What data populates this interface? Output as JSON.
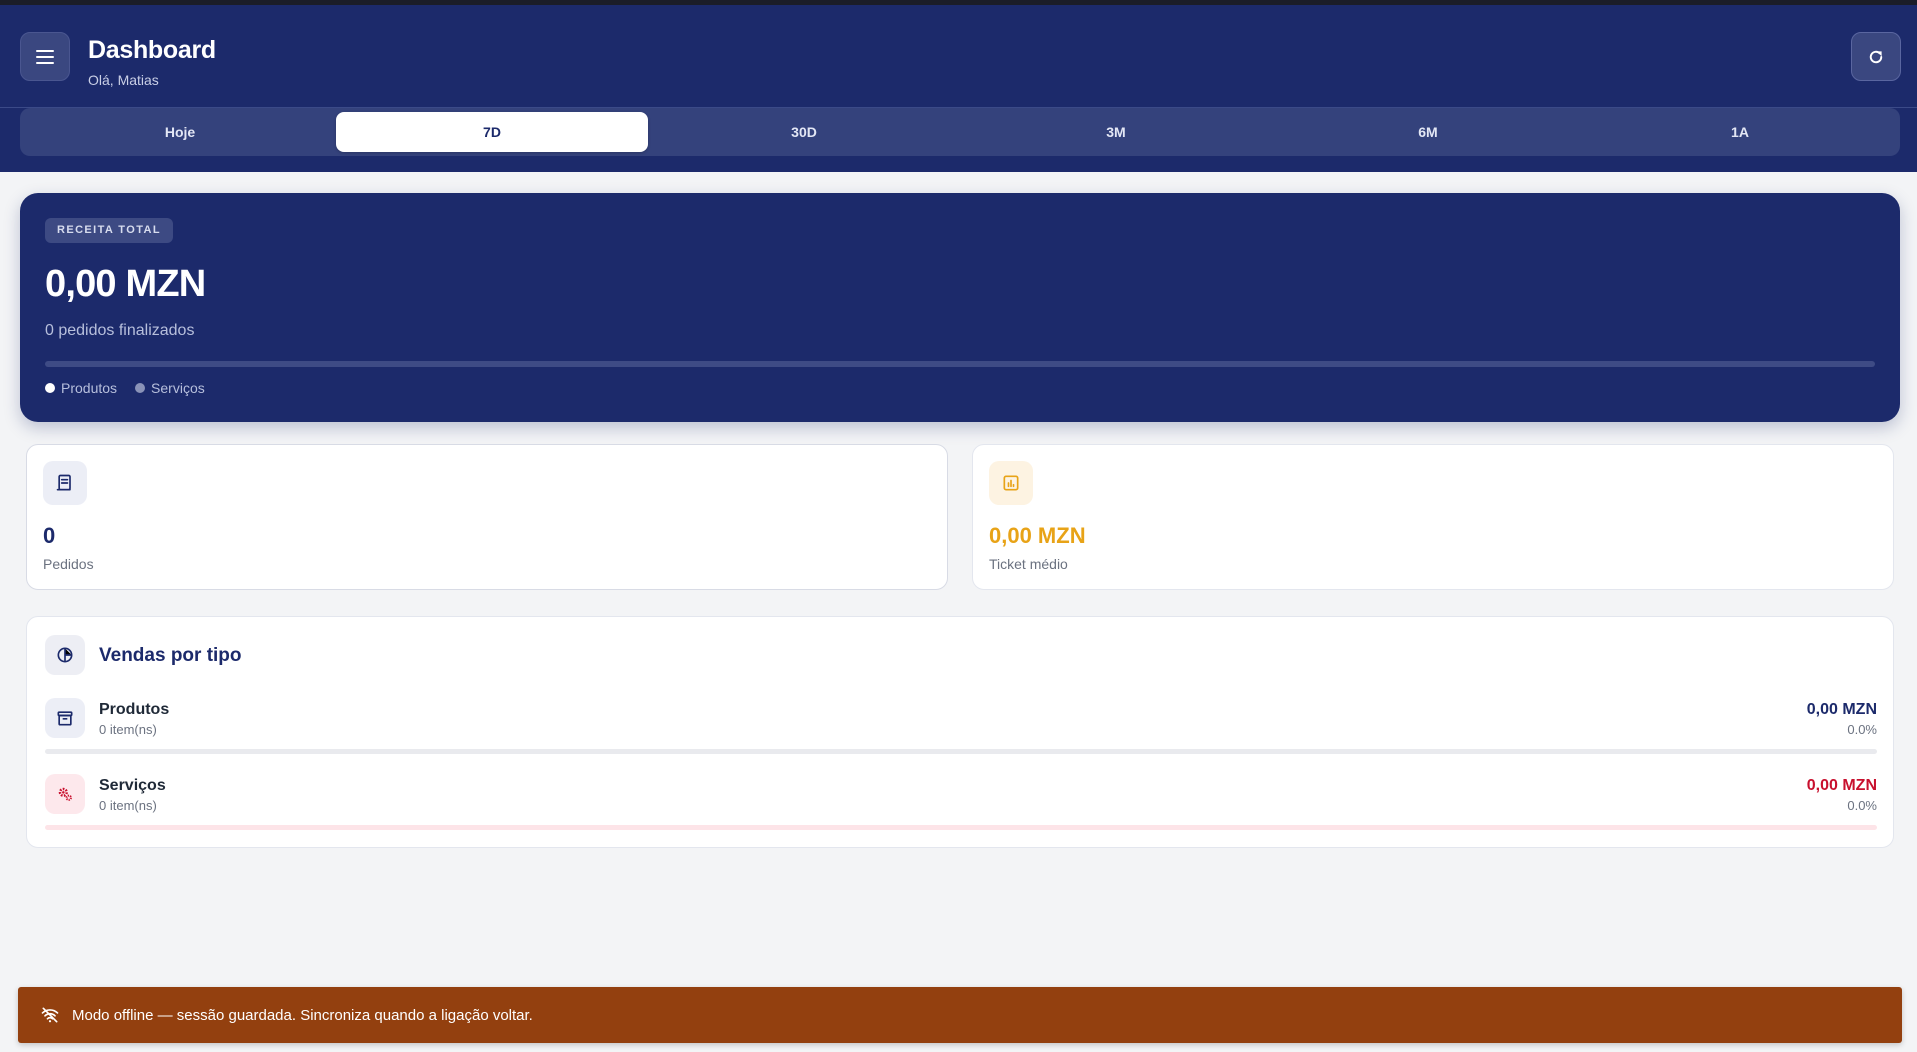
{
  "header": {
    "title": "Dashboard",
    "greeting": "Olá, Matias",
    "menu_icon": "hamburger-menu-icon",
    "refresh_icon": "refresh-icon",
    "bg_color": "#1c2a6b"
  },
  "period_tabs": [
    {
      "label": "Hoje",
      "active": false
    },
    {
      "label": "7D",
      "active": true
    },
    {
      "label": "30D",
      "active": false
    },
    {
      "label": "3M",
      "active": false
    },
    {
      "label": "6M",
      "active": false
    },
    {
      "label": "1A",
      "active": false
    }
  ],
  "revenue": {
    "badge": "RECEITA TOTAL",
    "amount": "0,00 MZN",
    "subtitle": "0 pedidos finalizados",
    "produtos_share": 0,
    "legend": [
      {
        "label": "Produtos",
        "color": "#ffffff"
      },
      {
        "label": "Serviços",
        "color": "#8a93b8"
      }
    ]
  },
  "stats": {
    "orders": {
      "value": "0",
      "label": "Pedidos",
      "icon": "receipt-icon",
      "color": "#1c2a6b"
    },
    "ticket": {
      "value": "0,00 MZN",
      "label": "Ticket médio",
      "icon": "bar-chart-icon",
      "color": "#e8a317"
    }
  },
  "sales_by_type": {
    "title": "Vendas por tipo",
    "icon": "pie-chart-icon",
    "rows": [
      {
        "name": "Produtos",
        "count": "0 item(ns)",
        "amount": "0,00 MZN",
        "percent": "0.0%",
        "share": 0,
        "icon": "archive-box-icon",
        "color": "#1c2a6b",
        "track_color": "#e9eaee"
      },
      {
        "name": "Serviços",
        "count": "0 item(ns)",
        "amount": "0,00 MZN",
        "percent": "0.0%",
        "share": 0,
        "icon": "gears-icon",
        "color": "#c8102e",
        "track_color": "#fde4e8"
      }
    ]
  },
  "offline_banner": {
    "icon": "wifi-off-icon",
    "text": "Modo offline — sessão guardada. Sincroniza quando a ligação voltar.",
    "bg_color": "#93400f"
  }
}
